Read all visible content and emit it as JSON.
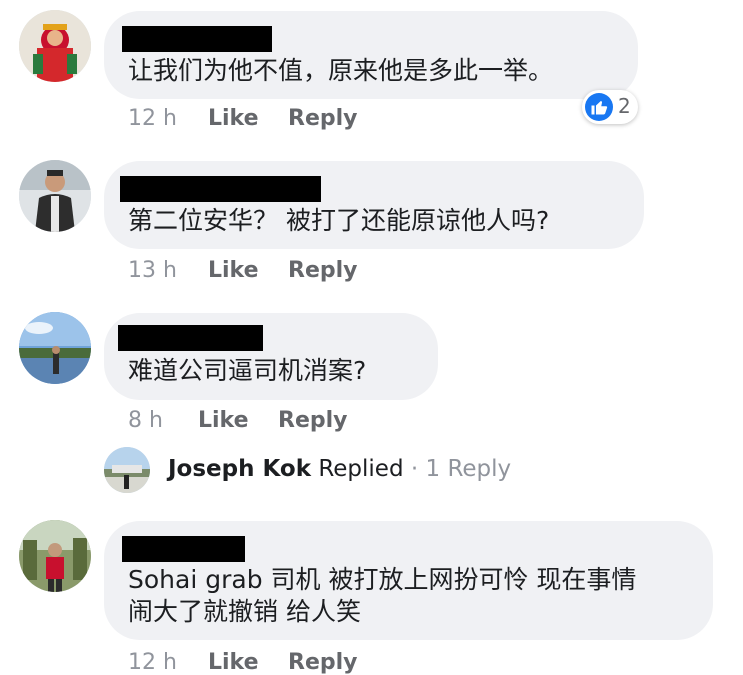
{
  "comments": [
    {
      "text": "让我们为他不值，原来他是多此一举。",
      "time": "12 h",
      "like_label": "Like",
      "reply_label": "Reply",
      "reaction": {
        "icon": "like-icon",
        "count": "2",
        "color": "#1877f2"
      }
    },
    {
      "text": "第二位安华？ 被打了还能原谅他人吗?",
      "time": "13 h",
      "like_label": "Like",
      "reply_label": "Reply"
    },
    {
      "text": "难道公司逼司机消案?",
      "time": "8 h",
      "like_label": "Like",
      "reply_label": "Reply",
      "replies": {
        "name": "Joseph Kok",
        "verb": "Replied",
        "separator": "·",
        "count": "1 Reply"
      }
    },
    {
      "text_line1": "Sohai grab 司机 被打放上网扮可怜 现在事情",
      "text_line2": "闹大了就撤销 给人笑",
      "time": "12 h",
      "like_label": "Like",
      "reply_label": "Reply"
    }
  ]
}
